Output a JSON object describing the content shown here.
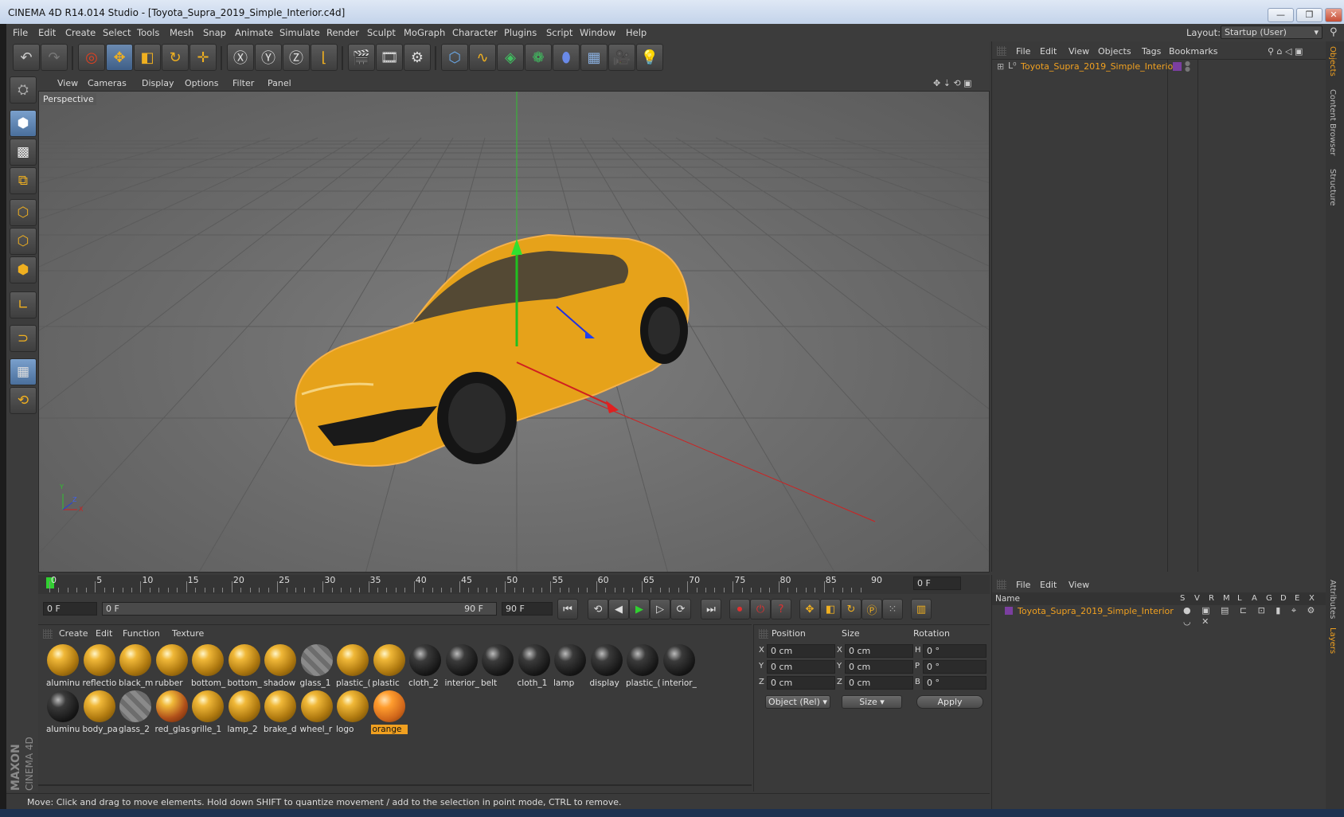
{
  "window": {
    "title": "CINEMA 4D R14.014 Studio - [Toyota_Supra_2019_Simple_Interior.c4d]",
    "buttons": [
      "—",
      "❐",
      "✕"
    ]
  },
  "menubar": {
    "items": [
      "File",
      "Edit",
      "Create",
      "Select",
      "Tools",
      "Mesh",
      "Snap",
      "Animate",
      "Simulate",
      "Render",
      "Sculpt",
      "MoGraph",
      "Character",
      "Plugins",
      "Script",
      "Window",
      "Help"
    ],
    "layout_label": "Layout:",
    "layout_value": "Startup (User)"
  },
  "viewport": {
    "menu": [
      "View",
      "Cameras",
      "Display",
      "Options",
      "Filter",
      "Panel"
    ],
    "label": "Perspective",
    "axis_y": "Y",
    "axis_x": "X",
    "axis_z": "Z"
  },
  "timeline": {
    "ticks": [
      "0",
      "5",
      "10",
      "15",
      "20",
      "25",
      "30",
      "35",
      "40",
      "45",
      "50",
      "55",
      "60",
      "65",
      "70",
      "75",
      "80",
      "85",
      "90"
    ],
    "current_frame": "0 F",
    "start_field": "0 F",
    "range_start": "0 F",
    "range_end": "90 F",
    "end_field": "90 F"
  },
  "materials": {
    "menu": [
      "Create",
      "Edit",
      "Function",
      "Texture"
    ],
    "items": [
      {
        "name": "aluminu",
        "kind": "gold"
      },
      {
        "name": "reflectio",
        "kind": "gold"
      },
      {
        "name": "black_m",
        "kind": "gold"
      },
      {
        "name": "rubber",
        "kind": "gold"
      },
      {
        "name": "bottom_",
        "kind": "gold"
      },
      {
        "name": "bottom_",
        "kind": "gold"
      },
      {
        "name": "shadow",
        "kind": "gold"
      },
      {
        "name": "glass_1",
        "kind": "glass"
      },
      {
        "name": "plastic_(",
        "kind": "gold"
      },
      {
        "name": "plastic",
        "kind": "gold"
      },
      {
        "name": "cloth_2",
        "kind": "black"
      },
      {
        "name": "interior_",
        "kind": "black"
      },
      {
        "name": "belt",
        "kind": "black"
      },
      {
        "name": "cloth_1",
        "kind": "black"
      },
      {
        "name": "lamp",
        "kind": "black"
      },
      {
        "name": "display",
        "kind": "black"
      },
      {
        "name": "plastic_(",
        "kind": "black"
      },
      {
        "name": "interior_",
        "kind": "black"
      },
      {
        "name": "aluminu",
        "kind": "black"
      },
      {
        "name": "body_pa",
        "kind": "gold"
      },
      {
        "name": "glass_2",
        "kind": "glass"
      },
      {
        "name": "red_glas",
        "kind": "redg"
      },
      {
        "name": "grille_1",
        "kind": "gold"
      },
      {
        "name": "lamp_2",
        "kind": "gold"
      },
      {
        "name": "brake_d",
        "kind": "gold"
      },
      {
        "name": "wheel_r",
        "kind": "gold"
      },
      {
        "name": "logo",
        "kind": "gold"
      },
      {
        "name": "orange",
        "kind": "orange",
        "selected": true
      }
    ]
  },
  "coords": {
    "headers": [
      "Position",
      "Size",
      "Rotation"
    ],
    "rows": [
      {
        "axis": "X",
        "pos": "0 cm",
        "size_axis": "X",
        "size": "0 cm",
        "rot_axis": "H",
        "rot": "0 °"
      },
      {
        "axis": "Y",
        "pos": "0 cm",
        "size_axis": "Y",
        "size": "0 cm",
        "rot_axis": "P",
        "rot": "0 °"
      },
      {
        "axis": "Z",
        "pos": "0 cm",
        "size_axis": "Z",
        "size": "0 cm",
        "rot_axis": "B",
        "rot": "0 °"
      }
    ],
    "mode": "Object (Rel)",
    "size_mode": "Size",
    "apply": "Apply"
  },
  "objects_panel": {
    "menu": [
      "File",
      "Edit",
      "View",
      "Objects",
      "Tags",
      "Bookmarks"
    ],
    "object_name": "Toyota_Supra_2019_Simple_Interior"
  },
  "layers_panel": {
    "menu": [
      "File",
      "Edit",
      "View"
    ],
    "name_header": "Name",
    "columns": [
      "S",
      "V",
      "R",
      "M",
      "L",
      "A",
      "G",
      "D",
      "E",
      "X"
    ],
    "layer_name": "Toyota_Supra_2019_Simple_Interior"
  },
  "side_tabs": {
    "top": [
      "Objects",
      "Content Browser",
      "Structure"
    ],
    "bottom": [
      "Attributes",
      "Layers"
    ]
  },
  "status": "Move: Click and drag to move elements. Hold down SHIFT to quantize movement / add to the selection in point mode, CTRL to remove.",
  "logo": {
    "brand": "MAXON",
    "product": "CINEMA 4D"
  },
  "colors": {
    "accent": "#f0a020",
    "selection": "#7b3fa0",
    "car": "#f0a018",
    "axis_x": "#e02020",
    "axis_y": "#20c020",
    "axis_z": "#2040e0"
  }
}
